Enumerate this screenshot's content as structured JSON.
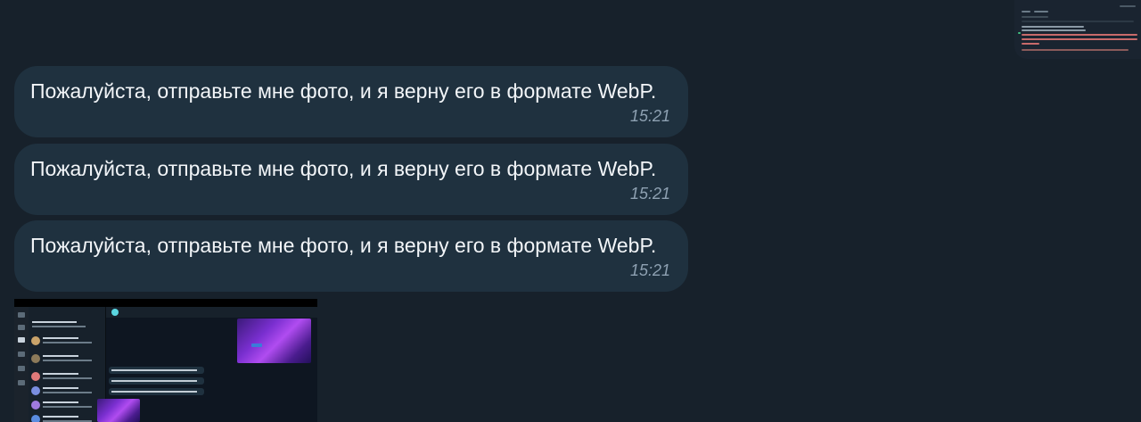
{
  "messages": [
    {
      "text": "Пожалуйста, отправьте мне фото, и я верну его в формате WebP.",
      "time": "15:21"
    },
    {
      "text": "Пожалуйста, отправьте мне фото, и я верну его в формате WebP.",
      "time": "15:21"
    },
    {
      "text": "Пожалуйста, отправьте мне фото, и я верну его в формате WebP.",
      "time": "15:21"
    }
  ],
  "attachments": [
    {
      "kind": "screenshot-image",
      "position": "top-right"
    },
    {
      "kind": "screenshot-image",
      "position": "bottom-left"
    }
  ],
  "colors": {
    "background": "#17212b",
    "bubble": "#1f313f",
    "text": "#f2f5f8",
    "time": "#8ea1b2"
  }
}
